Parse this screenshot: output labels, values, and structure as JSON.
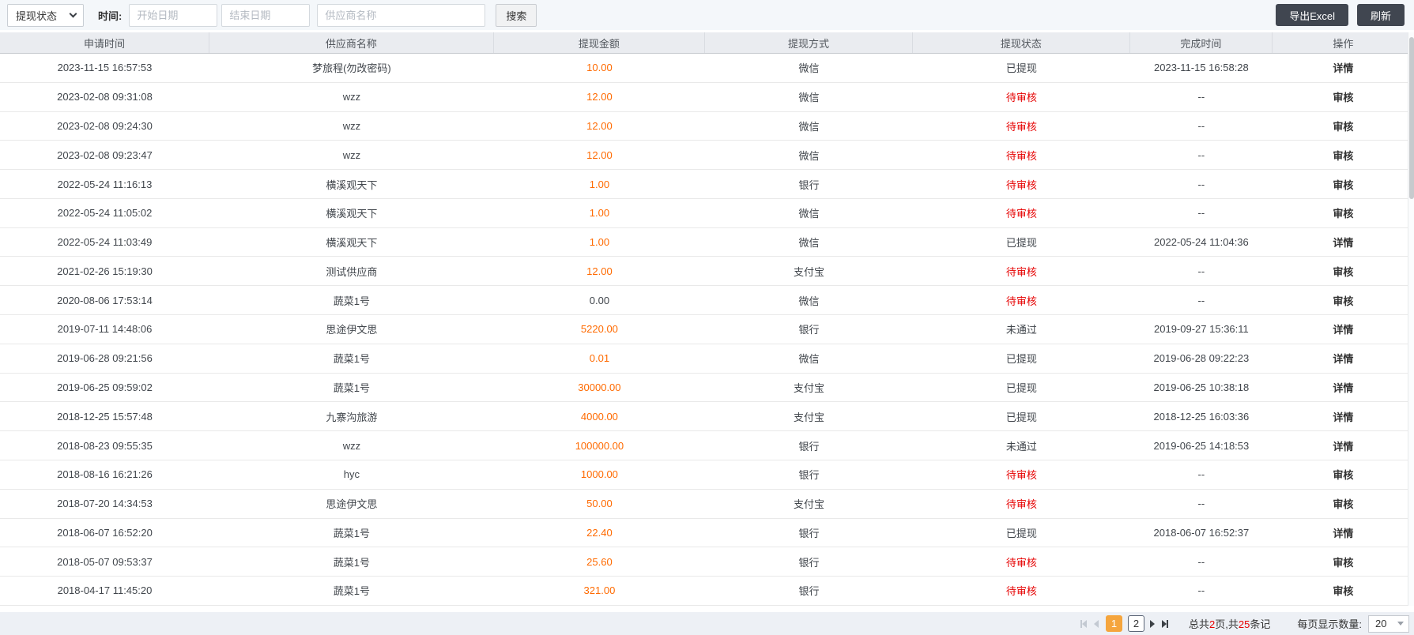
{
  "toolbar": {
    "status_filter_value": "提现状态",
    "time_label": "时间:",
    "start_date_placeholder": "开始日期",
    "end_date_placeholder": "结束日期",
    "supplier_placeholder": "供应商名称",
    "search_label": "搜索",
    "export_label": "导出Excel",
    "refresh_label": "刷新"
  },
  "table": {
    "columns": [
      "申请时间",
      "供应商名称",
      "提现金额",
      "提现方式",
      "提现状态",
      "完成时间",
      "操作"
    ],
    "row_keys": [
      "apply_time",
      "supplier",
      "amount",
      "method",
      "status",
      "finish_time",
      "action"
    ],
    "rows": [
      {
        "apply_time": "2023-11-15 16:57:53",
        "supplier": "梦旅程(勿改密码)",
        "amount": "10.00",
        "method": "微信",
        "status": "已提现",
        "finish_time": "2023-11-15 16:58:28",
        "action": "详情"
      },
      {
        "apply_time": "2023-02-08 09:31:08",
        "supplier": "wzz",
        "amount": "12.00",
        "method": "微信",
        "status": "待审核",
        "status_red": true,
        "finish_time": "--",
        "action": "审核"
      },
      {
        "apply_time": "2023-02-08 09:24:30",
        "supplier": "wzz",
        "amount": "12.00",
        "method": "微信",
        "status": "待审核",
        "status_red": true,
        "finish_time": "--",
        "action": "审核"
      },
      {
        "apply_time": "2023-02-08 09:23:47",
        "supplier": "wzz",
        "amount": "12.00",
        "method": "微信",
        "status": "待审核",
        "status_red": true,
        "finish_time": "--",
        "action": "审核"
      },
      {
        "apply_time": "2022-05-24 11:16:13",
        "supplier": "横溪观天下",
        "amount": "1.00",
        "method": "银行",
        "status": "待审核",
        "status_red": true,
        "finish_time": "--",
        "action": "审核"
      },
      {
        "apply_time": "2022-05-24 11:05:02",
        "supplier": "横溪观天下",
        "amount": "1.00",
        "method": "微信",
        "status": "待审核",
        "status_red": true,
        "finish_time": "--",
        "action": "审核"
      },
      {
        "apply_time": "2022-05-24 11:03:49",
        "supplier": "横溪观天下",
        "amount": "1.00",
        "method": "微信",
        "status": "已提现",
        "finish_time": "2022-05-24 11:04:36",
        "action": "详情"
      },
      {
        "apply_time": "2021-02-26 15:19:30",
        "supplier": "测试供应商",
        "amount": "12.00",
        "method": "支付宝",
        "status": "待审核",
        "status_red": true,
        "finish_time": "--",
        "action": "审核"
      },
      {
        "apply_time": "2020-08-06 17:53:14",
        "supplier": "蔬菜1号",
        "amount": "0.00",
        "amount_plain": true,
        "method": "微信",
        "status": "待审核",
        "status_red": true,
        "finish_time": "--",
        "action": "审核"
      },
      {
        "apply_time": "2019-07-11 14:48:06",
        "supplier": "思途伊文思",
        "amount": "5220.00",
        "method": "银行",
        "status": "未通过",
        "finish_time": "2019-09-27 15:36:11",
        "action": "详情"
      },
      {
        "apply_time": "2019-06-28 09:21:56",
        "supplier": "蔬菜1号",
        "amount": "0.01",
        "method": "微信",
        "status": "已提现",
        "finish_time": "2019-06-28 09:22:23",
        "action": "详情"
      },
      {
        "apply_time": "2019-06-25 09:59:02",
        "supplier": "蔬菜1号",
        "amount": "30000.00",
        "method": "支付宝",
        "status": "已提现",
        "finish_time": "2019-06-25 10:38:18",
        "action": "详情"
      },
      {
        "apply_time": "2018-12-25 15:57:48",
        "supplier": "九寨沟旅游",
        "amount": "4000.00",
        "method": "支付宝",
        "status": "已提现",
        "finish_time": "2018-12-25 16:03:36",
        "action": "详情"
      },
      {
        "apply_time": "2018-08-23 09:55:35",
        "supplier": "wzz",
        "amount": "100000.00",
        "method": "银行",
        "status": "未通过",
        "finish_time": "2019-06-25 14:18:53",
        "action": "详情"
      },
      {
        "apply_time": "2018-08-16 16:21:26",
        "supplier": "hyc",
        "amount": "1000.00",
        "method": "银行",
        "status": "待审核",
        "status_red": true,
        "finish_time": "--",
        "action": "审核"
      },
      {
        "apply_time": "2018-07-20 14:34:53",
        "supplier": "思途伊文思",
        "amount": "50.00",
        "method": "支付宝",
        "status": "待审核",
        "status_red": true,
        "finish_time": "--",
        "action": "审核"
      },
      {
        "apply_time": "2018-06-07 16:52:20",
        "supplier": "蔬菜1号",
        "amount": "22.40",
        "method": "银行",
        "status": "已提现",
        "finish_time": "2018-06-07 16:52:37",
        "action": "详情"
      },
      {
        "apply_time": "2018-05-07 09:53:37",
        "supplier": "蔬菜1号",
        "amount": "25.60",
        "method": "银行",
        "status": "待审核",
        "status_red": true,
        "finish_time": "--",
        "action": "审核"
      },
      {
        "apply_time": "2018-04-17 11:45:20",
        "supplier": "蔬菜1号",
        "amount": "321.00",
        "method": "银行",
        "status": "待审核",
        "status_red": true,
        "finish_time": "--",
        "action": "审核"
      }
    ]
  },
  "pagination": {
    "pages": [
      {
        "label": "1",
        "active": true
      },
      {
        "label": "2",
        "active": false
      }
    ],
    "summary": {
      "prefix": "总共",
      "page_count": "2",
      "middle": "页,共",
      "record_count": "25",
      "suffix": "条记"
    },
    "page_size_label": "每页显示数量:",
    "page_size_value": "20"
  },
  "colors": {
    "amount_orange": "#ff6a00",
    "status_red": "#e60000",
    "page_active_orange": "#f5a53d",
    "dark_button": "#404650",
    "toolbar_bg": "#f4f7fa",
    "header_bg": "#eaecf0",
    "pager_bg": "#edf0f5"
  }
}
